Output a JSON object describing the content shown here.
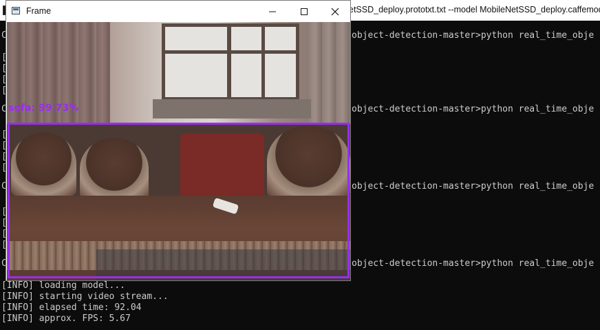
{
  "console": {
    "title": "etSSD_deploy.prototxt.txt --model MobileNetSSD_deploy.caffemodel",
    "prompt_lines": [
      {
        "left": "C",
        "right": "object-detection-master>python real_time_obje"
      },
      {
        "left": "C",
        "right": "object-detection-master>python real_time_obje"
      },
      {
        "left": "C",
        "right": "object-detection-master>python real_time_obje"
      },
      {
        "left": "C",
        "right": "object-detection-master>python real_time_obje"
      }
    ],
    "bracket": "[",
    "info_lines": [
      "[INFO] loading model...",
      "[INFO] starting video stream...",
      "[INFO] elapsed time: 92.04",
      "[INFO] approx. FPS: 5.67"
    ]
  },
  "frame_window": {
    "title": "Frame",
    "controls": {
      "minimize": "minimize-icon",
      "maximize": "maximize-icon",
      "close": "close-icon"
    }
  },
  "detection": {
    "label": "sofa: 99.73%",
    "color": "#9b2cf0"
  }
}
